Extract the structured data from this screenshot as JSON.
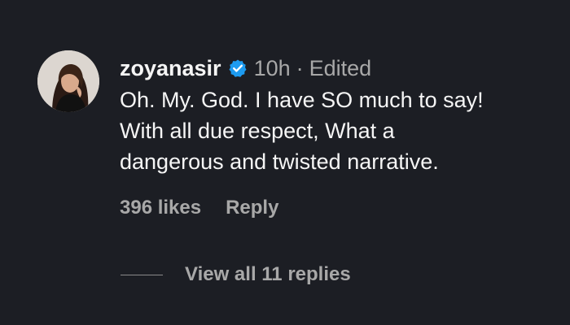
{
  "comment": {
    "username": "zoyanasir",
    "time": "10h",
    "separator": "·",
    "edited_label": "Edited",
    "text_lines": [
      "Oh. My. God. I have SO much to say!",
      "With all due respect, What a",
      "dangerous and twisted narrative."
    ],
    "likes_label": "396 likes",
    "reply_label": "Reply",
    "view_replies_label": "View all 11 replies",
    "verified_icon": "verified-badge-icon",
    "colors": {
      "background": "#1c1e24",
      "text": "#f5f5f5",
      "muted": "#a8a8a8",
      "verified": "#1d9bf0"
    }
  }
}
